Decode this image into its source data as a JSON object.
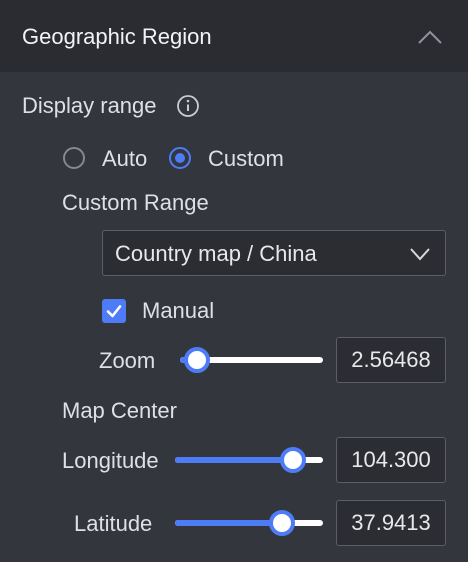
{
  "header": {
    "title": "Geographic Region",
    "collapse_icon": "chevron-up-icon"
  },
  "display_range": {
    "label": "Display range",
    "info_icon": "info-icon",
    "options": [
      {
        "label": "Auto",
        "checked": false
      },
      {
        "label": "Custom",
        "checked": true
      }
    ]
  },
  "custom_range": {
    "label": "Custom Range",
    "select_value": "Country map / China",
    "manual_label": "Manual",
    "manual_checked": true
  },
  "zoom": {
    "label": "Zoom",
    "value": "2.56468",
    "slider_fraction": 0.12
  },
  "map_center": {
    "label": "Map Center",
    "longitude": {
      "label": "Longitude",
      "value": "104.300",
      "slider_fraction": 0.8
    },
    "latitude": {
      "label": "Latitude",
      "value": "37.9413",
      "slider_fraction": 0.72
    }
  },
  "colors": {
    "accent": "#4d7cf6",
    "panel_bg": "#33363d",
    "header_bg": "#2a2c31"
  }
}
